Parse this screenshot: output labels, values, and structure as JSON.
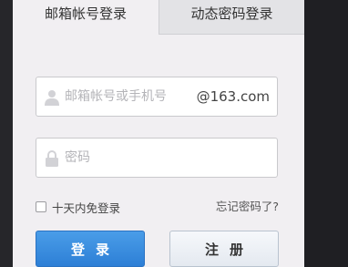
{
  "tabs": {
    "mail_login": "邮箱帐号登录",
    "sms_login": "动态密码登录"
  },
  "username": {
    "placeholder": "邮箱帐号或手机号",
    "suffix": "@163.com",
    "icon": "user-icon"
  },
  "password": {
    "placeholder": "密码",
    "icon": "lock-icon"
  },
  "options": {
    "remember_label": "十天内免登录",
    "remember_checked": false,
    "forgot_label": "忘记密码了?"
  },
  "buttons": {
    "login": "登录",
    "register": "注册"
  },
  "colors": {
    "login_button": "#2d7fd6",
    "panel_background": "#f1eff2",
    "placeholder_text": "#b4b4b8"
  }
}
